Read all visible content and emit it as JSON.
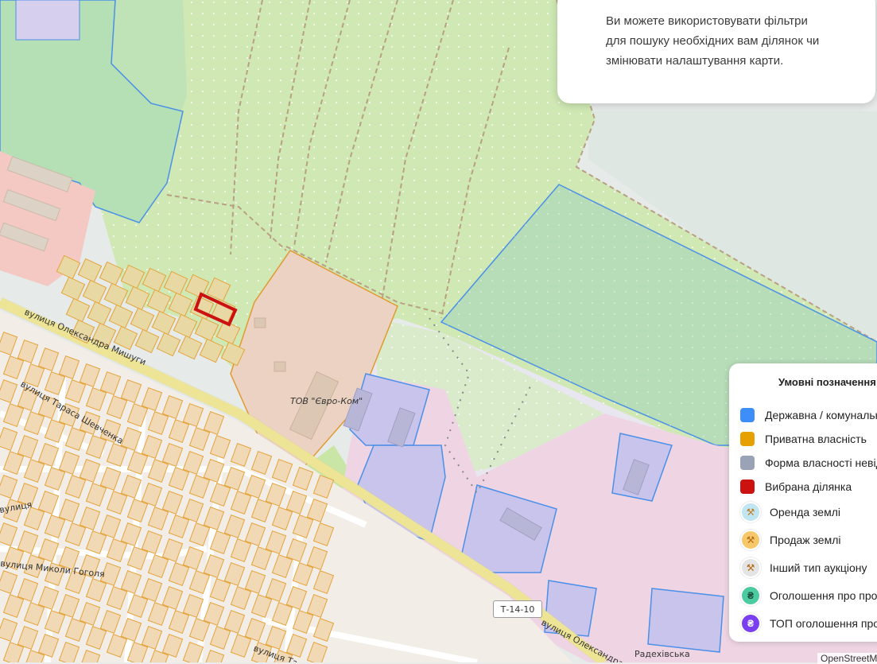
{
  "info_card": {
    "text": "Ви можете використовувати фільтри для пошуку необхідних вам ділянок чи змінювати налаштування карти."
  },
  "map": {
    "streets": {
      "mishugy": "вулиця Олександра Мишуги",
      "shevchenka": "вулиця Тараса Шевченка",
      "vulytsia": "вулиця",
      "hoholia": "вулиця Миколи Гоголя",
      "radekhivska": "Радехівська",
      "oleksandra_se": "вулиця Олександра",
      "ta": "вулиця Та",
      "radekhivska_street": "Радехівська вулиця"
    },
    "company_label": "ТОВ \"Євро-Ком\"",
    "road_sign": "Т-14-10",
    "colors": {
      "state": "#3b82f6",
      "private": "#e9a100",
      "unknown": "#9aa3b5",
      "selected": "#cc1111"
    }
  },
  "legend": {
    "title": "Умовні позначення",
    "items": [
      {
        "label": "Державна / комунальна",
        "color": "#3d8ef8",
        "icon": "square"
      },
      {
        "label": "Приватна власність",
        "color": "#e6a100",
        "icon": "square"
      },
      {
        "label": "Форма власності невідома",
        "color": "#9aa3b5",
        "icon": "square"
      },
      {
        "label": "Вибрана ділянка",
        "color": "#cc1111",
        "icon": "square"
      },
      {
        "label": "Оренда землі",
        "color": "#bfe6f2",
        "icon": "hammer-icon"
      },
      {
        "label": "Продаж землі",
        "color": "#f6c86a",
        "icon": "hammer-icon"
      },
      {
        "label": "Інший тип аукціону",
        "color": "#e4e4e4",
        "icon": "hammer-icon"
      },
      {
        "label": "Оголошення про продаж",
        "color": "#4ccaa0",
        "icon": "hryvnia-icon"
      },
      {
        "label": "ТОП оголошення продажу",
        "color": "#7a3ff0",
        "icon": "hryvnia-icon"
      }
    ]
  },
  "attribution": "OpenStreetMap"
}
